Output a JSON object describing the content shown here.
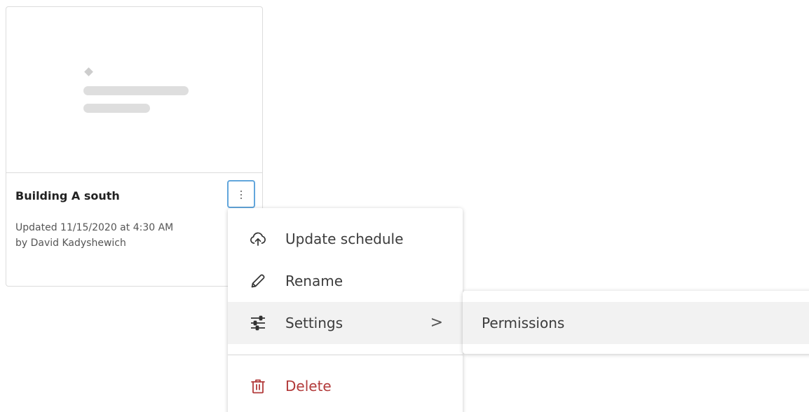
{
  "card": {
    "title": "Building A south",
    "updated": "Updated 11/15/2020 at 4:30 AM",
    "author": "by David Kadyshewich",
    "more_icon": "vertical-ellipsis-icon"
  },
  "menu": {
    "items": [
      {
        "label": "Update schedule",
        "icon": "cloud-upload-icon"
      },
      {
        "label": "Rename",
        "icon": "pencil-icon"
      },
      {
        "label": "Settings",
        "icon": "sliders-icon",
        "has_submenu": true,
        "chevron": ">"
      },
      {
        "label": "Delete",
        "icon": "trash-icon",
        "color": "#b23a3a"
      }
    ]
  },
  "submenu": {
    "items": [
      {
        "label": "Permissions"
      }
    ]
  },
  "colors": {
    "focus_border": "#62a6dc",
    "hover_bg": "#f2f2f2",
    "danger": "#b23a3a"
  }
}
